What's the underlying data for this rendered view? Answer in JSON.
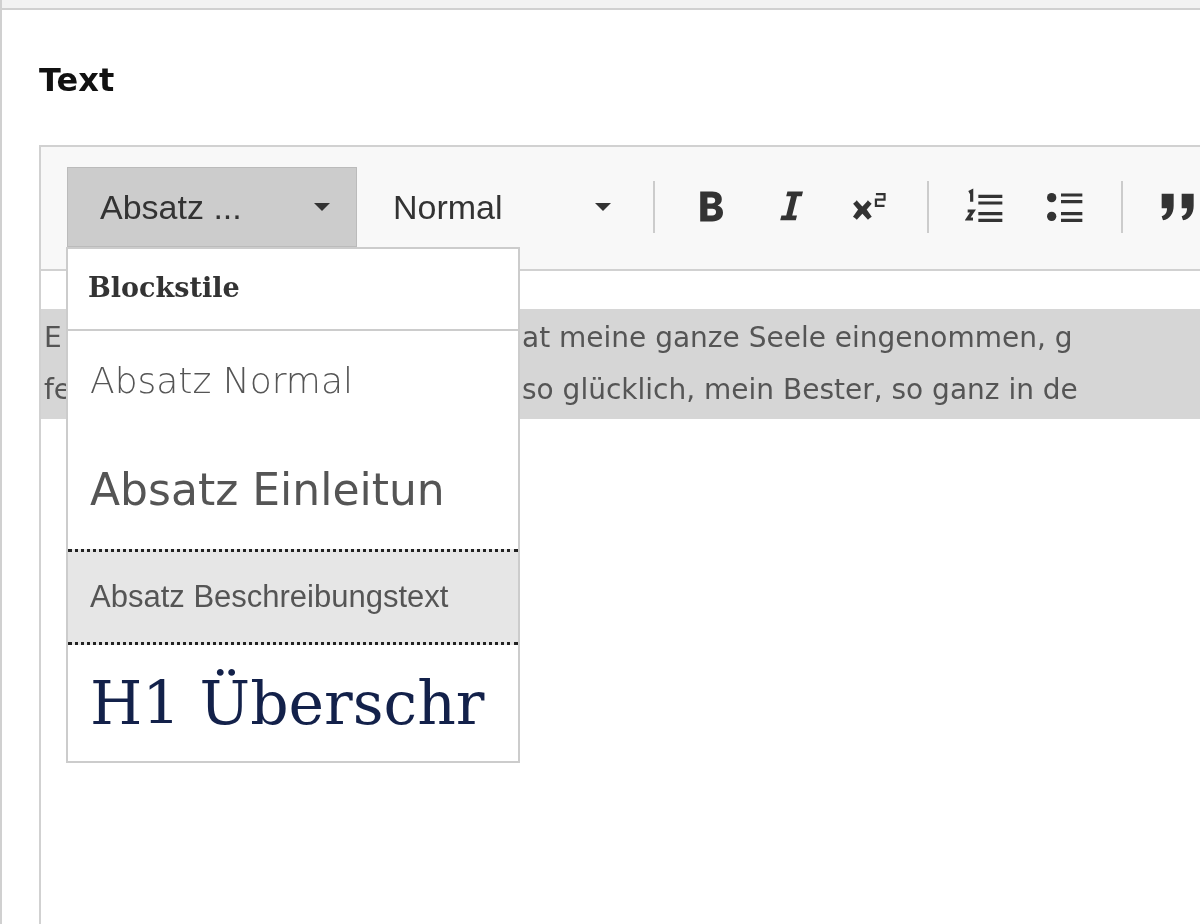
{
  "field_label": "Text",
  "toolbar": {
    "combos": [
      {
        "label": "Absatz ...",
        "open": true
      },
      {
        "label": "Normal",
        "open": false
      }
    ],
    "button_groups": [
      [
        {
          "kind": "bold"
        },
        {
          "kind": "italic"
        },
        {
          "kind": "superscript"
        }
      ],
      [
        {
          "kind": "numbered-list"
        },
        {
          "kind": "bullet-list"
        }
      ],
      [
        {
          "kind": "quote"
        }
      ]
    ]
  },
  "paragraph": {
    "selected": true,
    "lines": [
      {
        "left": "E",
        "right": "at meine ganze Seele eingenommen, g"
      },
      {
        "left": "fe",
        "right": "so glücklich, mein Bester, so ganz in de"
      }
    ]
  },
  "dropdown": {
    "heading": "Blockstile",
    "items": [
      {
        "kind": "normal",
        "label": "Absatz Normal",
        "selected": false
      },
      {
        "kind": "intro",
        "label": "Absatz Einleitun",
        "selected": false
      },
      {
        "kind": "description",
        "label": "Absatz Beschreibungstext",
        "selected": true
      },
      {
        "kind": "h1",
        "label": "H1 Überschr",
        "selected": false
      }
    ]
  }
}
